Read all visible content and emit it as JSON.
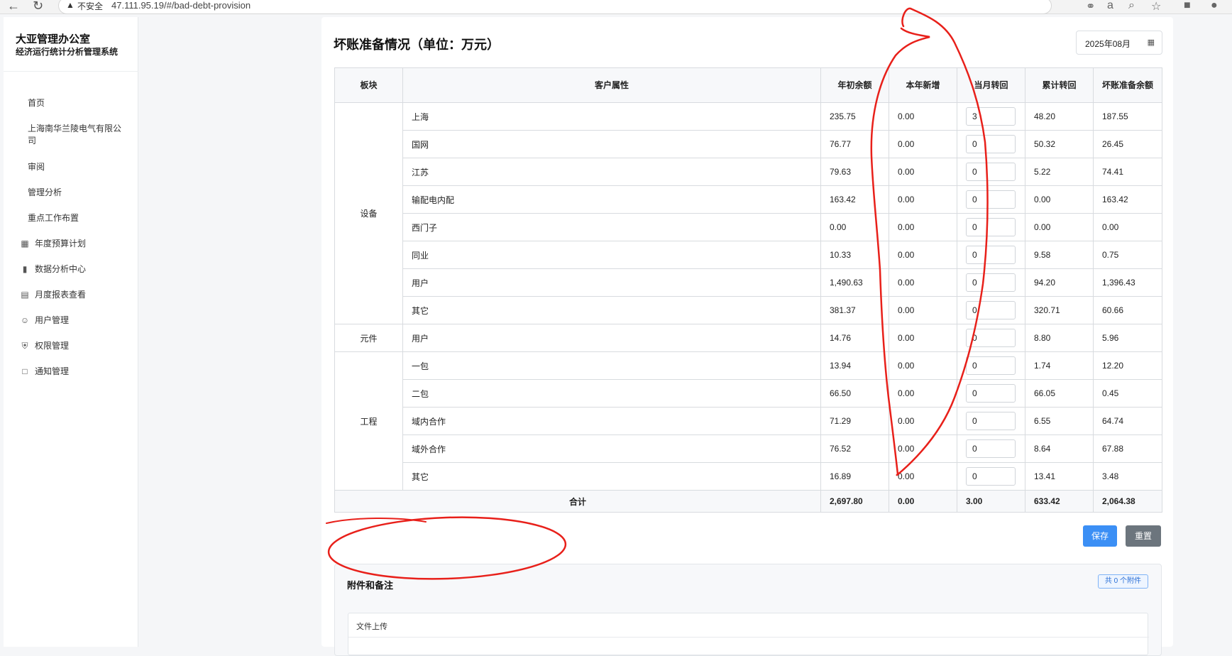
{
  "browser": {
    "insecure_label": "不安全",
    "url": "47.111.95.19/#/bad-debt-provision"
  },
  "sidebar": {
    "org_title": "大亚管理办公室",
    "org_subtitle": "经济运行统计分析管理系统",
    "items": [
      {
        "label": "首页",
        "icon": ""
      },
      {
        "label": "上海南华兰陵电气有限公司",
        "icon": ""
      },
      {
        "label": "审阅",
        "icon": ""
      },
      {
        "label": "管理分析",
        "icon": ""
      },
      {
        "label": "重点工作布置",
        "icon": ""
      },
      {
        "label": "年度预算计划",
        "icon": "calculator-icon"
      },
      {
        "label": "数据分析中心",
        "icon": "bar-chart-icon"
      },
      {
        "label": "月度报表查看",
        "icon": "document-icon"
      },
      {
        "label": "用户管理",
        "icon": "users-icon"
      },
      {
        "label": "权限管理",
        "icon": "shield-icon"
      },
      {
        "label": "通知管理",
        "icon": "message-icon"
      }
    ]
  },
  "page": {
    "title": "坏账准备情况（单位：万元）",
    "month": "2025年08月"
  },
  "table": {
    "headers": [
      "板块",
      "客户属性",
      "年初余额",
      "本年新增",
      "当月转回",
      "累计转回",
      "坏账准备余额"
    ],
    "groups": [
      {
        "segment": "设备",
        "rows": [
          {
            "attr": "上海",
            "opening": "235.75",
            "added": "0.00",
            "monthly": "3",
            "cumulative": "48.20",
            "balance": "187.55"
          },
          {
            "attr": "国网",
            "opening": "76.77",
            "added": "0.00",
            "monthly": "0",
            "cumulative": "50.32",
            "balance": "26.45"
          },
          {
            "attr": "江苏",
            "opening": "79.63",
            "added": "0.00",
            "monthly": "0",
            "cumulative": "5.22",
            "balance": "74.41"
          },
          {
            "attr": "输配电内配",
            "opening": "163.42",
            "added": "0.00",
            "monthly": "0",
            "cumulative": "0.00",
            "balance": "163.42"
          },
          {
            "attr": "西门子",
            "opening": "0.00",
            "added": "0.00",
            "monthly": "0",
            "cumulative": "0.00",
            "balance": "0.00"
          },
          {
            "attr": "同业",
            "opening": "10.33",
            "added": "0.00",
            "monthly": "0",
            "cumulative": "9.58",
            "balance": "0.75"
          },
          {
            "attr": "用户",
            "opening": "1,490.63",
            "added": "0.00",
            "monthly": "0",
            "cumulative": "94.20",
            "balance": "1,396.43"
          },
          {
            "attr": "其它",
            "opening": "381.37",
            "added": "0.00",
            "monthly": "0",
            "cumulative": "320.71",
            "balance": "60.66"
          }
        ]
      },
      {
        "segment": "元件",
        "rows": [
          {
            "attr": "用户",
            "opening": "14.76",
            "added": "0.00",
            "monthly": "0",
            "cumulative": "8.80",
            "balance": "5.96"
          }
        ]
      },
      {
        "segment": "工程",
        "rows": [
          {
            "attr": "一包",
            "opening": "13.94",
            "added": "0.00",
            "monthly": "0",
            "cumulative": "1.74",
            "balance": "12.20"
          },
          {
            "attr": "二包",
            "opening": "66.50",
            "added": "0.00",
            "monthly": "0",
            "cumulative": "66.05",
            "balance": "0.45"
          },
          {
            "attr": "域内合作",
            "opening": "71.29",
            "added": "0.00",
            "monthly": "0",
            "cumulative": "6.55",
            "balance": "64.74"
          },
          {
            "attr": "域外合作",
            "opening": "76.52",
            "added": "0.00",
            "monthly": "0",
            "cumulative": "8.64",
            "balance": "67.88"
          },
          {
            "attr": "其它",
            "opening": "16.89",
            "added": "0.00",
            "monthly": "0",
            "cumulative": "13.41",
            "balance": "3.48"
          }
        ]
      }
    ],
    "total": {
      "label": "合计",
      "opening": "2,697.80",
      "added": "0.00",
      "monthly": "3.00",
      "cumulative": "633.42",
      "balance": "2,064.38"
    }
  },
  "actions": {
    "save_label": "保存",
    "reset_label": "重置"
  },
  "attachments": {
    "title": "附件和备注",
    "badge": "共 0 个附件",
    "upload_label": "文件上传"
  },
  "colors": {
    "primary": "#3b8ff5",
    "secondary": "#6c757d",
    "annotation": "#e8201a"
  }
}
